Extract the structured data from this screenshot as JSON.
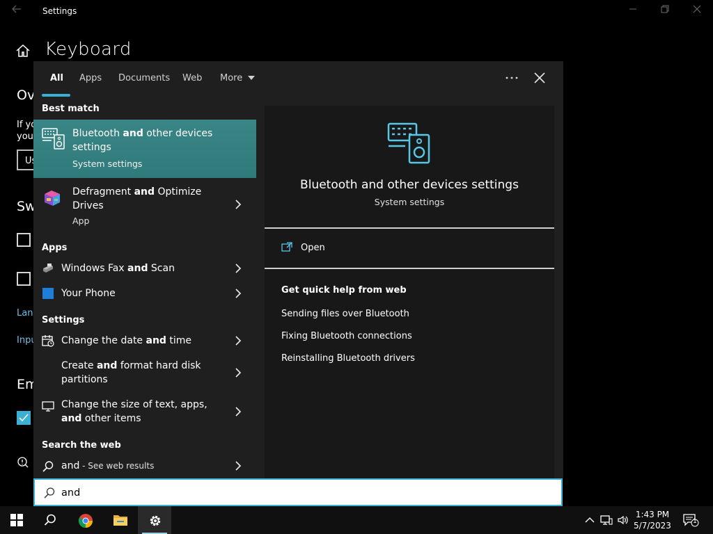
{
  "window": {
    "app_title": "Settings",
    "page_title": "Keyboard",
    "bg_fragments": [
      "Ov",
      "If yo",
      "you",
      "Us",
      "Sw",
      "Lang",
      "Inpu",
      "Em"
    ]
  },
  "search": {
    "tabs": [
      {
        "label": "All",
        "active": true
      },
      {
        "label": "Apps"
      },
      {
        "label": "Documents"
      },
      {
        "label": "Web"
      },
      {
        "label": "More"
      }
    ],
    "query": "and",
    "sections": {
      "best_match": "Best match",
      "apps": "Apps",
      "settings": "Settings",
      "search_web": "Search the web"
    },
    "best_match": {
      "title_pre": "Bluetooth ",
      "title_bold": "and",
      "title_post": " other devices settings",
      "subtitle": "System settings"
    },
    "defrag": {
      "title_pre": "Defragment ",
      "title_bold": "and",
      "title_post": " Optimize Drives",
      "subtitle": "App"
    },
    "apps": [
      {
        "pre": "Windows Fax ",
        "bold": "and",
        "post": " Scan"
      },
      {
        "pre": "Your Phone",
        "bold": "",
        "post": ""
      }
    ],
    "settings": [
      {
        "pre": "Change the date ",
        "bold": "and",
        "post": " time"
      },
      {
        "pre": "Create ",
        "bold": "and",
        "post": " format hard disk partitions"
      },
      {
        "pre": "Change the size of text, apps, ",
        "bold": "and",
        "post": " other items"
      }
    ],
    "web": {
      "query": "and",
      "suffix": " - See web results"
    },
    "preview": {
      "title": "Bluetooth and other devices settings",
      "subtitle": "System settings",
      "open_label": "Open",
      "help_heading": "Get quick help from web",
      "links": [
        "Sending files over Bluetooth",
        "Fixing Bluetooth connections",
        "Reinstalling Bluetooth drivers"
      ]
    }
  },
  "taskbar": {
    "time": "1:43 PM",
    "date": "5/7/2023",
    "notification_count": "1"
  },
  "colors": {
    "accent": "#3bb0d4",
    "best_match_bg": "#357f80",
    "flyout_bg": "#1f1f1f",
    "preview_bg": "#181818"
  }
}
